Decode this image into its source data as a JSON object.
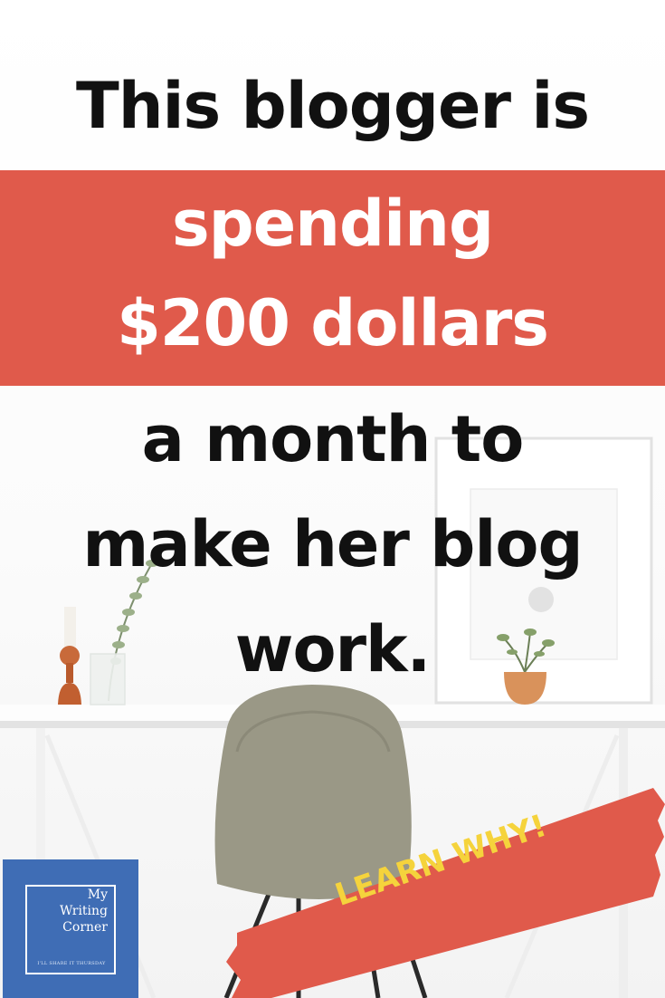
{
  "headline": {
    "line1": "This blogger is",
    "line2": "spending",
    "line3": "$200 dollars",
    "line4": "a month to",
    "line5": "make her blog",
    "line6": "work."
  },
  "cta": {
    "label": "LEARN WHY!"
  },
  "brand": {
    "name_line1": "My",
    "name_line2": "Writing",
    "name_line3": "Corner",
    "tagline": "I'LL SHARE IT THURSDAY"
  },
  "colors": {
    "accent_red": "#e05a4b",
    "brand_blue": "#3f6db5",
    "cta_yellow": "#f5d33c",
    "headline_black": "#111111"
  }
}
